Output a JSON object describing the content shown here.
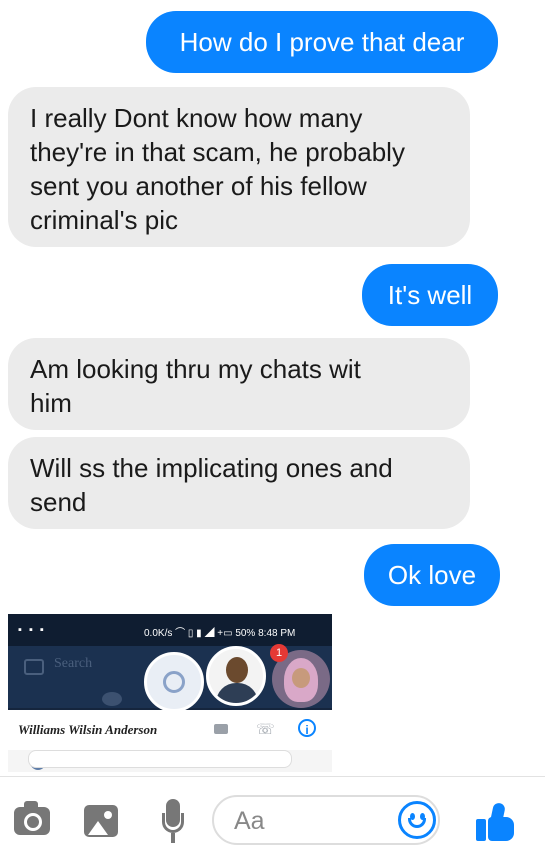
{
  "messages": [
    {
      "id": "m1",
      "direction": "outgoing",
      "text": "How do I prove that dear"
    },
    {
      "id": "m2",
      "direction": "incoming",
      "lines": [
        "I really Dont know how many",
        "they're in that scam, he probably",
        "sent you another of his fellow",
        "criminal's pic"
      ]
    },
    {
      "id": "m3",
      "direction": "outgoing",
      "text": "It's well"
    },
    {
      "id": "m4",
      "direction": "incoming",
      "lines": [
        "Am looking thru my chats wit",
        "him"
      ]
    },
    {
      "id": "m5",
      "direction": "incoming",
      "lines": [
        "Will ss the implicating ones and",
        "send"
      ]
    },
    {
      "id": "m6",
      "direction": "outgoing",
      "text": "Ok love"
    }
  ],
  "attachment": {
    "status_left": "▪ ▪ ▪",
    "status_right": "0.0K/s ⌒ ▯ ▮ ◢ +▭ 50% 8:48 PM",
    "search_text": "Search",
    "badge": "1",
    "contact_name": "Williams Wilsin Anderson",
    "info_glyph": "i",
    "phone_glyph": "☏"
  },
  "composer": {
    "placeholder": "Aa"
  },
  "colors": {
    "outgoing": "#0a84ff",
    "incoming": "#ebebeb",
    "icon_gray": "#777777",
    "accent": "#0a84ff"
  }
}
